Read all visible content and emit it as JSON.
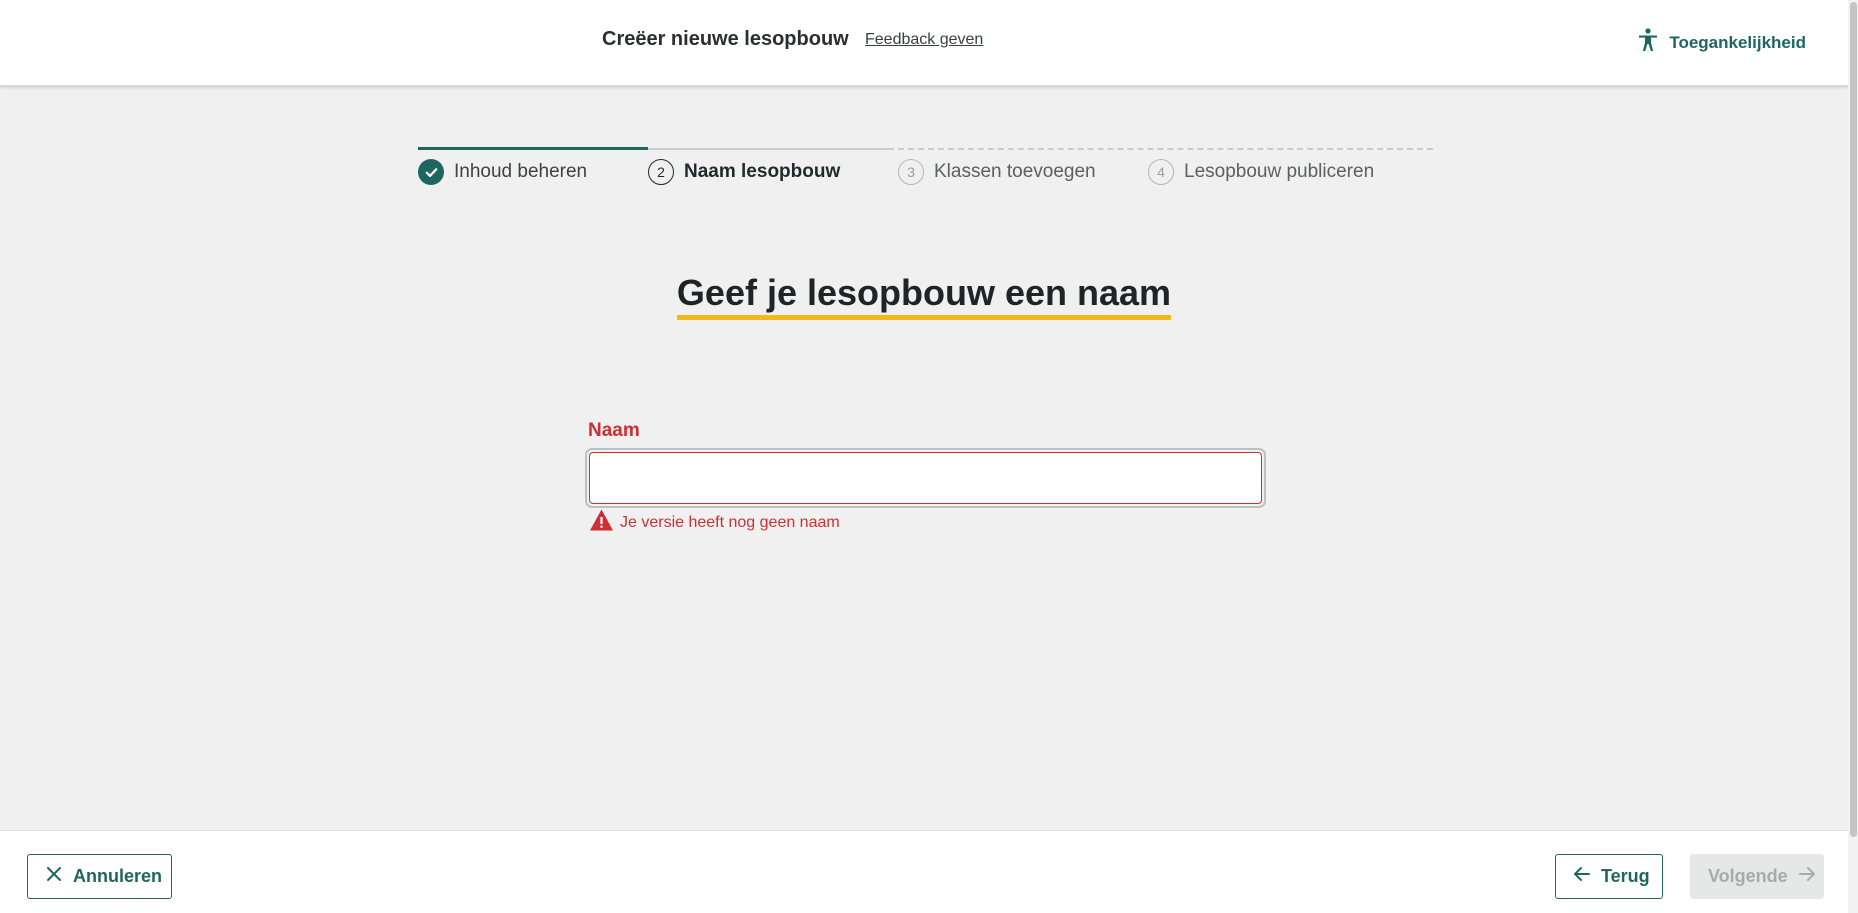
{
  "header": {
    "title": "Creëer nieuwe lesopbouw",
    "feedback_label": "Feedback geven",
    "accessibility_label": "Toegankelijkheid"
  },
  "stepper": {
    "steps": [
      {
        "number": "✓",
        "label": "Inhoud beheren",
        "state": "done"
      },
      {
        "number": "2",
        "label": "Naam lesopbouw",
        "state": "active"
      },
      {
        "number": "3",
        "label": "Klassen toevoegen",
        "state": "todo"
      },
      {
        "number": "4",
        "label": "Lesopbouw publiceren",
        "state": "todo"
      }
    ]
  },
  "main": {
    "heading": "Geef je lesopbouw een naam",
    "name_field": {
      "label": "Naam",
      "value": "",
      "error": "Je versie heeft nog geen naam"
    }
  },
  "footer": {
    "cancel_label": "Annuleren",
    "back_label": "Terug",
    "next_label": "Volgende"
  },
  "colors": {
    "primary": "#1f6661",
    "error": "#cf2f34",
    "highlight": "#f5b81c",
    "background": "#eff0ef"
  }
}
